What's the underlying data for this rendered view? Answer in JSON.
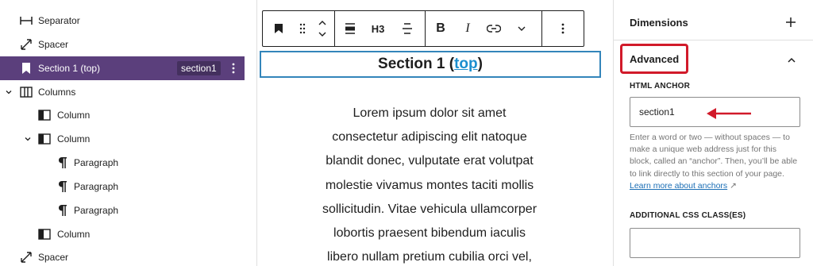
{
  "list_view": {
    "items": [
      {
        "label": "Separator",
        "icon": "separator-icon"
      },
      {
        "label": "Spacer",
        "icon": "spacer-icon"
      },
      {
        "label": "Section 1 (top)",
        "icon": "bookmark-icon",
        "selected": true,
        "anchor": "section1"
      },
      {
        "label": "Columns",
        "icon": "columns-icon",
        "expanded": true
      },
      {
        "label": "Column",
        "icon": "column-icon"
      },
      {
        "label": "Column",
        "icon": "column-icon",
        "expanded": true
      },
      {
        "label": "Paragraph",
        "icon": "pilcrow-icon"
      },
      {
        "label": "Paragraph",
        "icon": "pilcrow-icon"
      },
      {
        "label": "Paragraph",
        "icon": "pilcrow-icon"
      },
      {
        "label": "Column",
        "icon": "column-icon"
      },
      {
        "label": "Spacer",
        "icon": "spacer-icon"
      }
    ]
  },
  "toolbar": {
    "heading_level": "H3",
    "bold": "B",
    "italic": "I"
  },
  "editor": {
    "heading_text": "Section 1 (",
    "heading_link": "top",
    "heading_close": ")",
    "paragraph_lines": [
      "Lorem ipsum dolor sit amet",
      "consectetur adipiscing elit natoque",
      "blandit donec, vulputate erat volutpat",
      "molestie vivamus montes taciti mollis",
      "sollicitudin. Vitae vehicula ullamcorper",
      "lobortis praesent bibendum iaculis",
      "libero nullam pretium cubilia orci vel,"
    ]
  },
  "sidebar": {
    "dimensions_title": "Dimensions",
    "advanced_title": "Advanced",
    "html_anchor_label": "HTML ANCHOR",
    "html_anchor_value": "section1",
    "help_text": "Enter a word or two — without spaces — to make a unique web address just for this block, called an “anchor”. Then, you’ll be able to link directly to this section of your page.",
    "help_link": "Learn more about anchors",
    "help_link_icon": "↗",
    "css_class_label": "ADDITIONAL CSS CLASS(ES)",
    "css_class_value": ""
  },
  "colors": {
    "selected_row": "#5b3f7c",
    "anchor_badge": "#44305e",
    "block_outline": "#3385ba",
    "link": "#1b8ecf",
    "annotation_red": "#d11a2a"
  }
}
